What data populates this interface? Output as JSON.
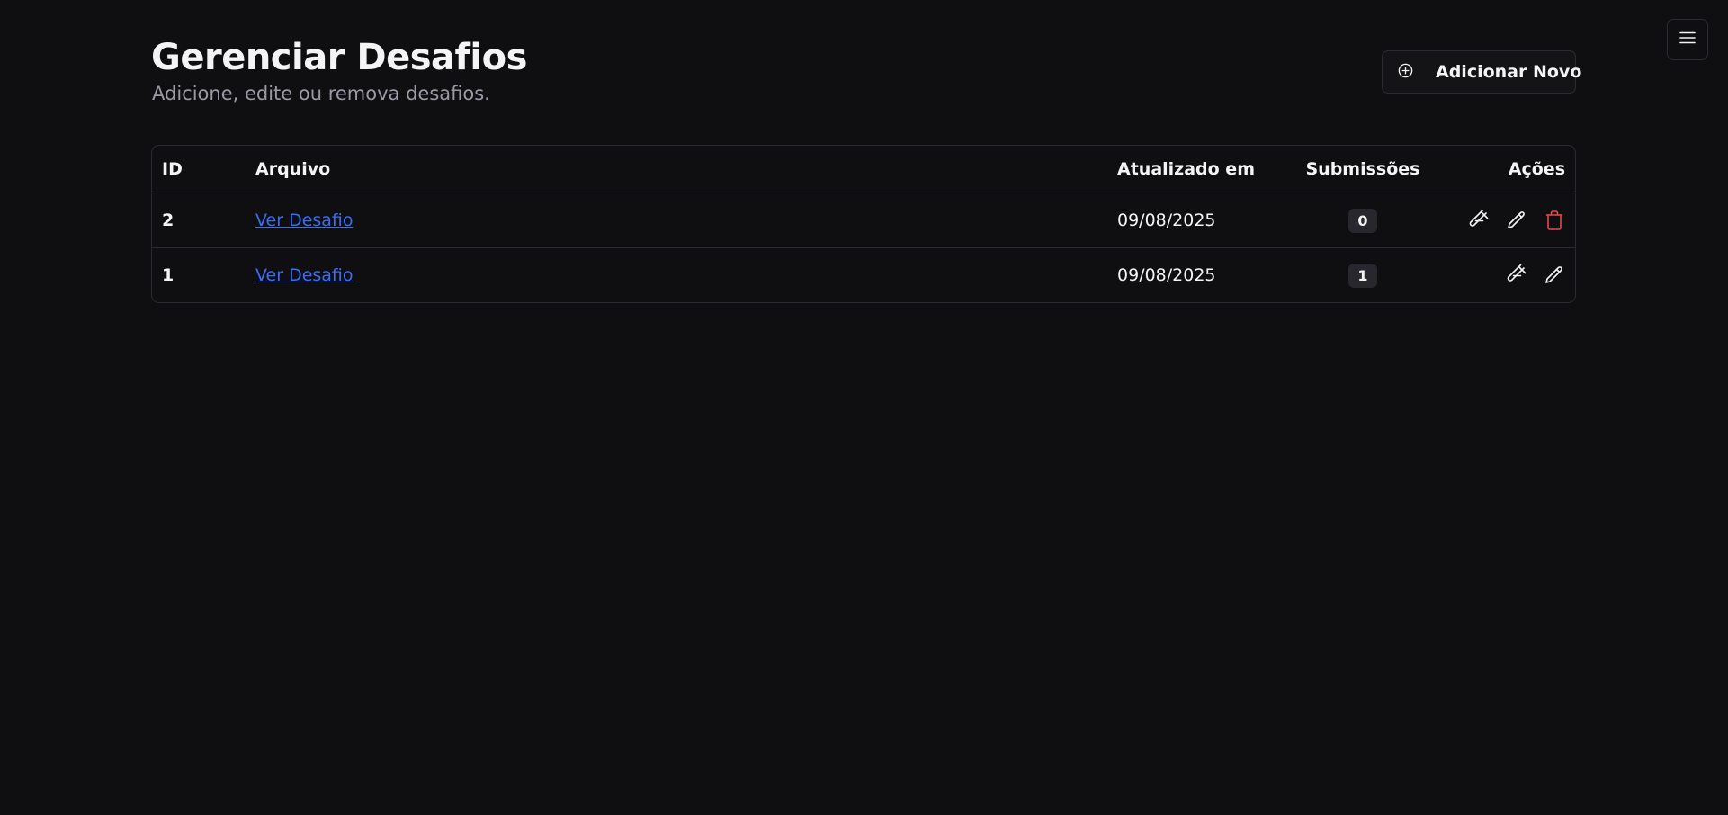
{
  "header": {
    "title": "Gerenciar Desafios",
    "subtitle": "Adicione, edite ou remova desafios.",
    "add_button_label": "Adicionar Novo",
    "add_button_icon": "plus-circle-icon"
  },
  "nav": {
    "menu_icon": "hamburger-menu-icon"
  },
  "table": {
    "columns": {
      "id": "ID",
      "file": "Arquivo",
      "updated": "Atualizado em",
      "submissions": "Submissões",
      "actions": "Ações"
    },
    "rows": [
      {
        "id": "2",
        "file_link": "Ver Desafio",
        "updated": "09/08/2025",
        "submissions": "0",
        "actions": [
          "test-tube-icon",
          "pencil-icon",
          "trash-icon"
        ]
      },
      {
        "id": "1",
        "file_link": "Ver Desafio",
        "updated": "09/08/2025",
        "submissions": "1",
        "actions": [
          "test-tube-icon",
          "pencil-icon"
        ]
      }
    ]
  },
  "colors": {
    "background": "#0f0f11",
    "link": "#3b6cf6",
    "danger": "#e5484d",
    "muted_text": "#9a9aa6"
  }
}
